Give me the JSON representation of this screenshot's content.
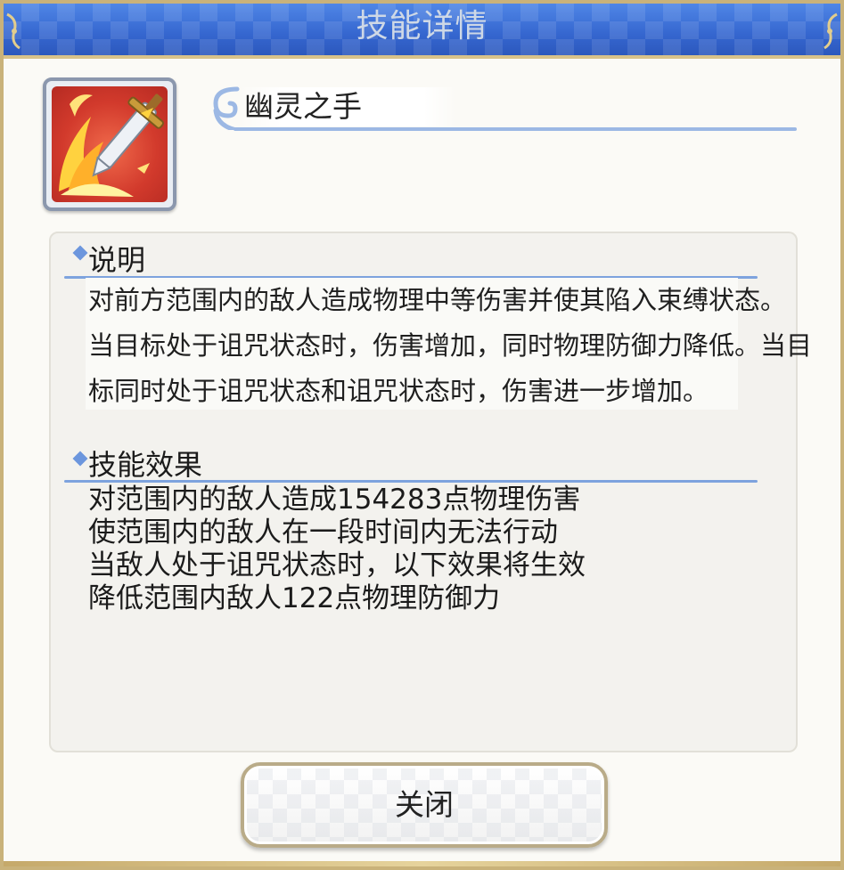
{
  "dialog": {
    "title": "技能详情"
  },
  "skill": {
    "name": "幽灵之手",
    "icon": "ghost-hand-skill-icon"
  },
  "description": {
    "heading": "说明",
    "lines": [
      "对前方范围内的敌人造成物理中等伤害并使其陷入束缚状态。",
      "当目标处于诅咒状态时，伤害增加，同时物理防御力降低。当目",
      "标同时处于诅咒状态和诅咒状态时，伤害进一步增加。"
    ]
  },
  "effects": {
    "heading": "技能效果",
    "items": [
      "对范围内的敌人造成154283点物理伤害",
      "使范围内的敌人在一段时间内无法行动",
      "当敌人处于诅咒状态时，以下效果将生效",
      "降低范围内敌人122点物理防御力"
    ]
  },
  "buttons": {
    "close_label": "关闭"
  },
  "colors": {
    "header_blue": "#3566cf",
    "accent_line": "#7da3de",
    "frame_gold": "#c9b27a"
  }
}
